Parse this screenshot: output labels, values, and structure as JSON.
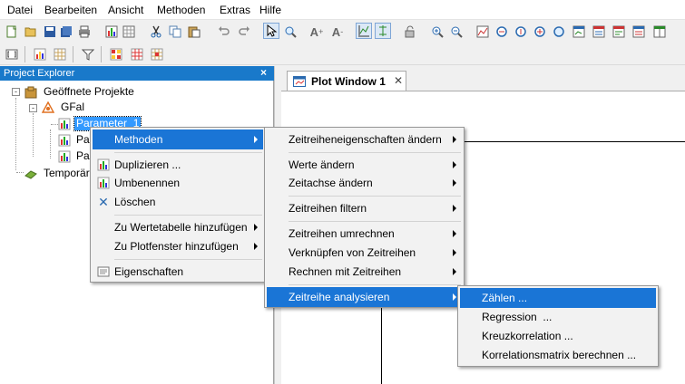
{
  "menubar": {
    "items": [
      "Datei",
      "Bearbeiten",
      "Ansicht",
      "Methoden",
      "Extras",
      "Hilfe"
    ]
  },
  "explorer": {
    "title": "Project Explorer",
    "close": "×",
    "tree": {
      "root": "Geöffnete Projekte",
      "project": "GFal",
      "selected_item": "Parameter_1",
      "item_2": "Pa",
      "item_3": "Pa",
      "temp": "Temporär"
    }
  },
  "plot_tab": {
    "title": "Plot Window 1",
    "close": "✕"
  },
  "context_menu": {
    "items": [
      {
        "label": "Methoden",
        "submenu": true,
        "highlighted": true,
        "icon": "none"
      },
      {
        "label": "Duplizieren ...",
        "icon": "duplicate-icon"
      },
      {
        "label": "Umbenennen",
        "icon": "rename-icon"
      },
      {
        "label": "Löschen",
        "icon": "delete-icon"
      },
      {
        "label": "Zu Wertetabelle hinzufügen",
        "submenu": true
      },
      {
        "label": "Zu Plotfenster hinzufügen",
        "submenu": true
      },
      {
        "label": "Eigenschaften",
        "icon": "properties-icon"
      }
    ]
  },
  "methoden_menu": {
    "items": [
      "Zeitreiheneigenschaften ändern",
      "Werte ändern",
      "Zeitachse ändern",
      "Zeitreihen filtern",
      "Zeitreihen umrechnen",
      "Verknüpfen von Zeitreihen",
      "Rechnen mit Zeitreihen",
      "Zeitreihe analysieren"
    ]
  },
  "analyse_menu": {
    "items": [
      "Zählen ...",
      "Regression  ...",
      "Kreuzkorrelation ...",
      "Korrelationsmatrix berechnen ..."
    ]
  },
  "colors": {
    "menu_highlight": "#1a75d6",
    "explorer_header": "#1979ca",
    "tree_selection": "#3399ff"
  }
}
